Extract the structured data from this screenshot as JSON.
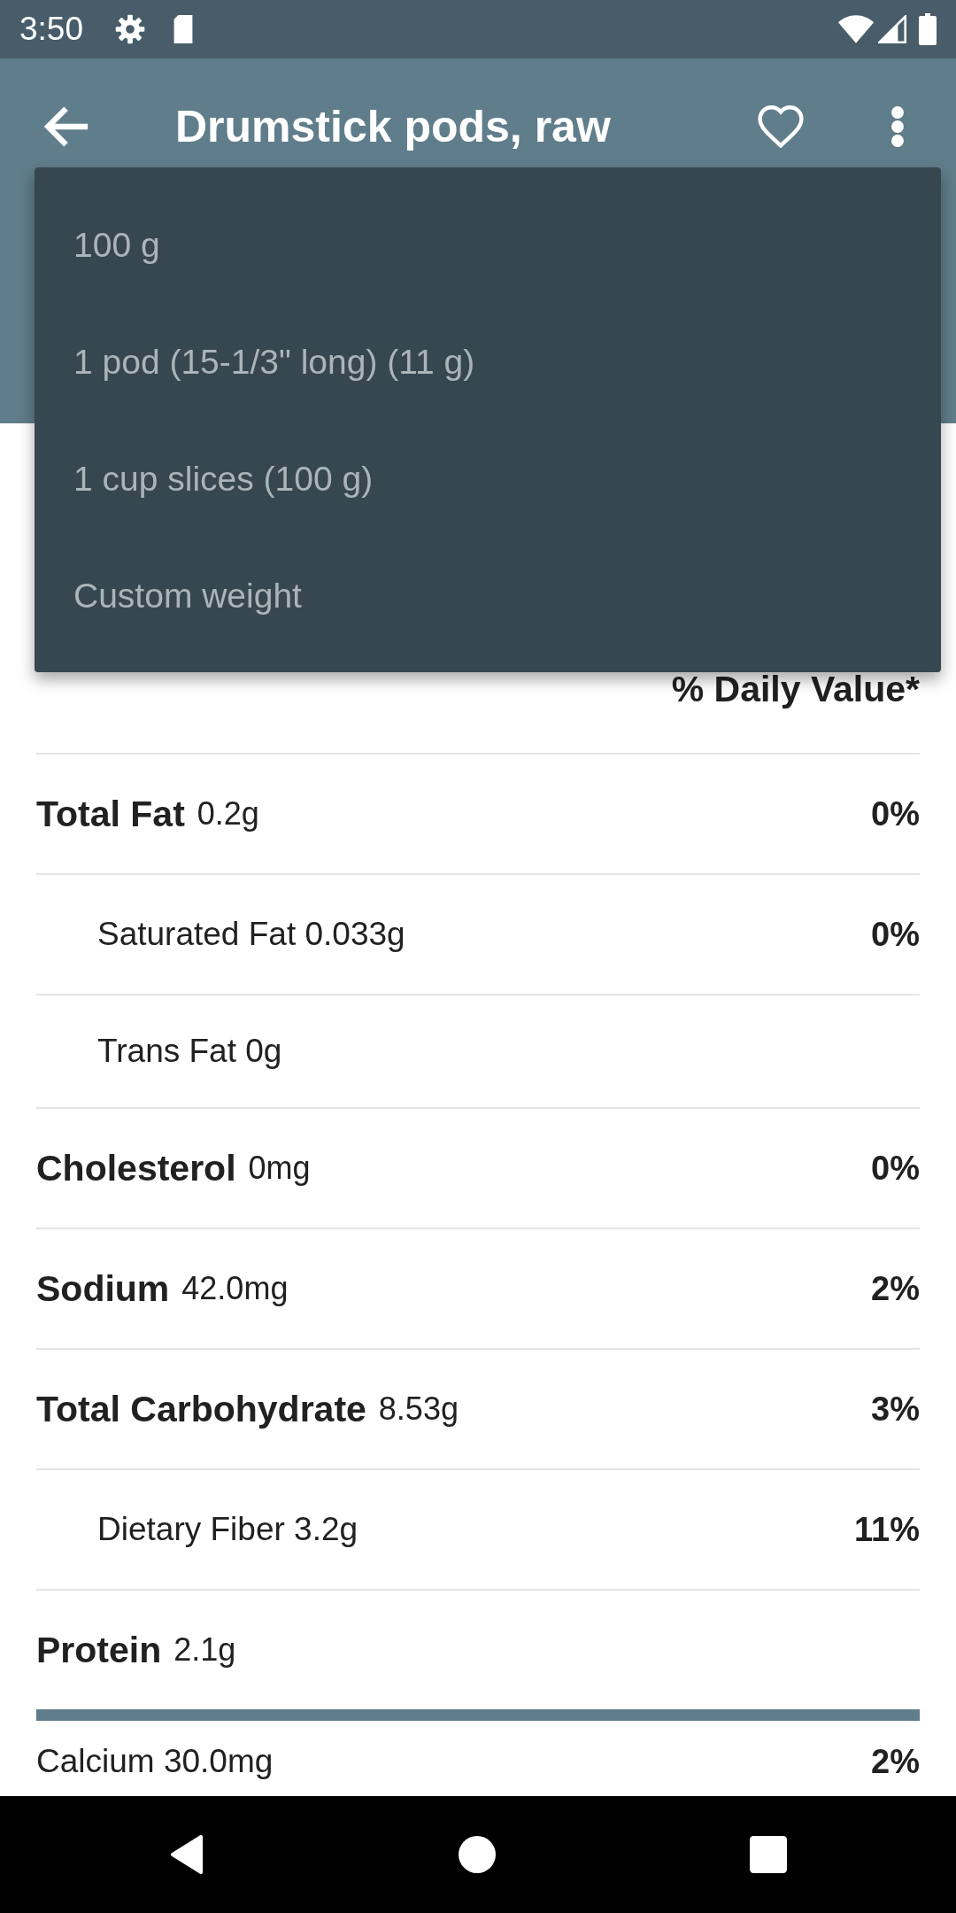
{
  "status_bar": {
    "time": "3:50"
  },
  "app_bar": {
    "title": "Drumstick pods, raw",
    "favorited": false
  },
  "serving_menu": {
    "items": [
      {
        "label": "100 g"
      },
      {
        "label": "1 pod (15-1/3\" long) (11 g)"
      },
      {
        "label": "1 cup slices (100 g)"
      },
      {
        "label": "Custom weight"
      }
    ]
  },
  "nutrition": {
    "daily_value_header": "% Daily Value*",
    "rows": [
      {
        "kind": "main",
        "name": "Total Fat",
        "amount": "0.2g",
        "daily_value": "0%"
      },
      {
        "kind": "sub",
        "text": "Saturated Fat 0.033g",
        "daily_value": "0%"
      },
      {
        "kind": "sub",
        "text": "Trans Fat 0g"
      },
      {
        "kind": "main",
        "name": "Cholesterol",
        "amount": "0mg",
        "daily_value": "0%"
      },
      {
        "kind": "main",
        "name": "Sodium",
        "amount": "42.0mg",
        "daily_value": "2%"
      },
      {
        "kind": "main",
        "name": "Total Carbohydrate",
        "amount": "8.53g",
        "daily_value": "3%"
      },
      {
        "kind": "sub",
        "text": "Dietary Fiber 3.2g",
        "daily_value": "11%"
      },
      {
        "kind": "main",
        "name": "Protein",
        "amount": "2.1g"
      }
    ],
    "minerals": [
      {
        "text": "Calcium 30.0mg",
        "daily_value": "2%"
      }
    ]
  }
}
